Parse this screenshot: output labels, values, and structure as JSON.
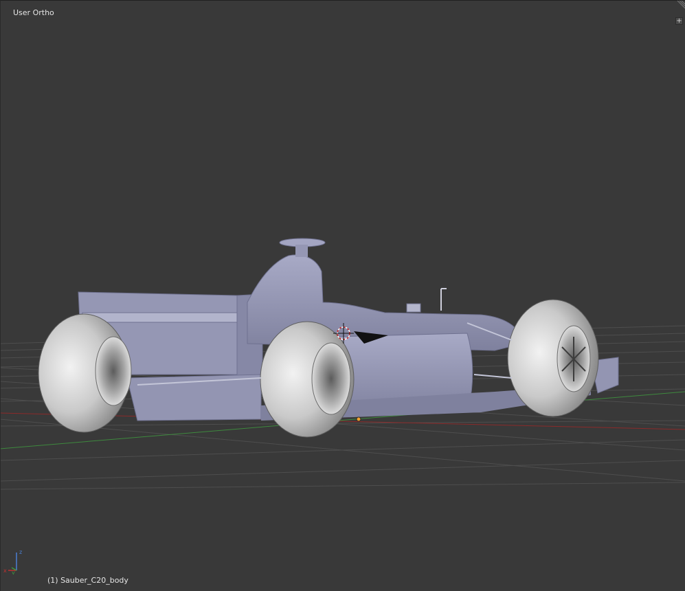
{
  "viewport": {
    "view_name": "User Ortho",
    "active_object": "(1) Sauber_C20_body",
    "colors": {
      "background": "#393939",
      "grid": "#4d4d4d",
      "x_axis": "#8c2a2a",
      "y_axis": "#3e8a3e",
      "body": "#8f91b0"
    }
  },
  "gizmo": {
    "x_label": "x",
    "y_label": "y",
    "z_label": "z"
  },
  "toolbar": {
    "plus_icon": "plus-icon",
    "corner_icon": "area-split-corner-icon"
  }
}
